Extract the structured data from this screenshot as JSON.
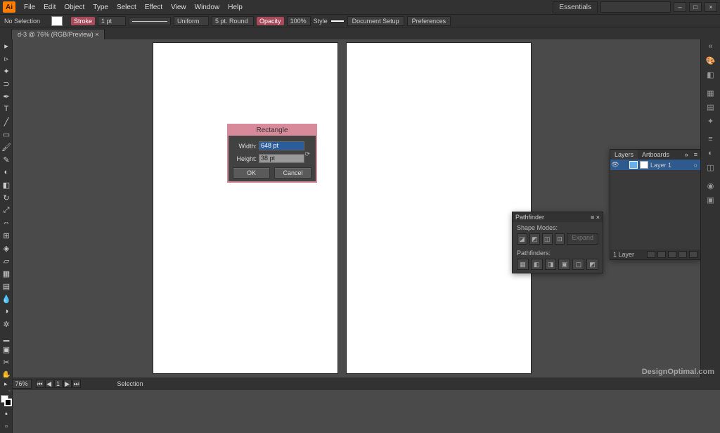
{
  "app": {
    "logo": "Ai",
    "workspace": "Essentials"
  },
  "menu": [
    "File",
    "Edit",
    "Object",
    "Type",
    "Select",
    "Effect",
    "View",
    "Window",
    "Help"
  ],
  "control": {
    "selection": "No Selection",
    "stroke_label": "Stroke",
    "stroke_weight": "1 pt",
    "uniform": "Uniform",
    "brush": "5 pt. Round",
    "opacity_label": "Opacity",
    "opacity": "100%",
    "style_label": "Style",
    "doc_setup": "Document Setup",
    "prefs": "Preferences"
  },
  "tab": {
    "label": "d-3 @ 76% (RGB/Preview)"
  },
  "dialog": {
    "title": "Rectangle",
    "width_label": "Width:",
    "width_value": "648 pt",
    "height_label": "Height:",
    "height_value": "38 pt",
    "ok": "OK",
    "cancel": "Cancel"
  },
  "pathfinder": {
    "title": "Pathfinder",
    "shape_modes": "Shape Modes:",
    "expand": "Expand",
    "pathfinders": "Pathfinders:"
  },
  "layers": {
    "tab_layers": "Layers",
    "tab_artboards": "Artboards",
    "layer1": "Layer 1",
    "count": "1 Layer"
  },
  "status": {
    "zoom": "76%",
    "artboard_nav": "1",
    "tool": "Selection"
  },
  "watermark": "DesignOptimal.com"
}
